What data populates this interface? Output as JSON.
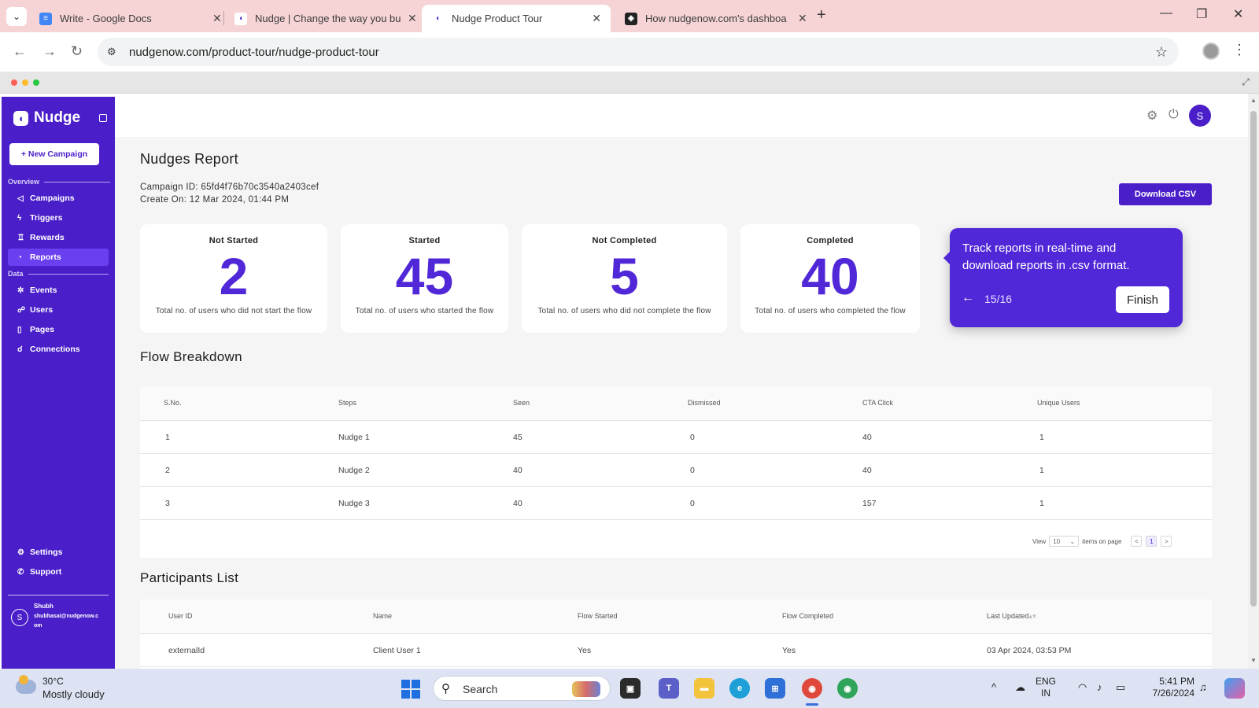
{
  "browser": {
    "tabs": [
      {
        "title": "Write - Google Docs",
        "favicon_color": "#4285f4",
        "active": false
      },
      {
        "title": "Nudge | Change the way you bu",
        "favicon_color": "#4a1fc9",
        "active": false
      },
      {
        "title": "Nudge Product Tour",
        "favicon_color": "#4a1fc9",
        "active": true
      },
      {
        "title": "How nudgenow.com's dashboa",
        "favicon_color": "#222222",
        "active": false
      }
    ],
    "url": "nudgenow.com/product-tour/nudge-product-tour"
  },
  "sidebar": {
    "brand": "Nudge",
    "new_campaign": "+ New Campaign",
    "section_overview": "Overview",
    "overview_items": [
      {
        "label": "Campaigns",
        "icon": "megaphone-icon",
        "active": false
      },
      {
        "label": "Triggers",
        "icon": "lightning-icon",
        "active": false
      },
      {
        "label": "Rewards",
        "icon": "trophy-icon",
        "active": false
      },
      {
        "label": "Reports",
        "icon": "pie-chart-icon",
        "active": true
      }
    ],
    "section_data": "Data",
    "data_items": [
      {
        "label": "Events",
        "icon": "sparkle-icon"
      },
      {
        "label": "Users",
        "icon": "users-icon"
      },
      {
        "label": "Pages",
        "icon": "page-icon"
      },
      {
        "label": "Connections",
        "icon": "connections-icon"
      }
    ],
    "bottom_items": [
      {
        "label": "Settings",
        "icon": "gear-icon"
      },
      {
        "label": "Support",
        "icon": "phone-icon"
      }
    ],
    "user": {
      "initial": "S",
      "name": "Shubh",
      "email": "shubhasai@nudgenow.com"
    }
  },
  "header": {
    "avatar_initial": "S"
  },
  "report": {
    "title": "Nudges Report",
    "campaign_id": "Campaign ID: 65fd4f76b70c3540a2403cef",
    "created_on": "Create On: 12 Mar 2024, 01:44 PM",
    "download_label": "Download CSV"
  },
  "stats": [
    {
      "label": "Not Started",
      "value": "2",
      "desc": "Total no. of users who did not start the flow"
    },
    {
      "label": "Started",
      "value": "45",
      "desc": "Total no. of users who started the flow"
    },
    {
      "label": "Not Completed",
      "value": "5",
      "desc": "Total no. of users who did not complete the flow"
    },
    {
      "label": "Completed",
      "value": "40",
      "desc": "Total no. of users who completed the flow"
    }
  ],
  "tooltip": {
    "text": "Track reports in real-time and download reports in .csv format.",
    "step": "15/16",
    "finish_label": "Finish"
  },
  "flow_breakdown": {
    "title": "Flow Breakdown",
    "columns": [
      "S.No.",
      "Steps",
      "Seen",
      "Dismissed",
      "CTA Click",
      "Unique Users"
    ],
    "rows": [
      [
        "1",
        "Nudge 1",
        "45",
        "0",
        "40",
        "1"
      ],
      [
        "2",
        "Nudge 2",
        "40",
        "0",
        "40",
        "1"
      ],
      [
        "3",
        "Nudge 3",
        "40",
        "0",
        "157",
        "1"
      ]
    ],
    "pager": {
      "view_label": "View",
      "per_page": "10",
      "items_label": "items on page",
      "prev": "<",
      "page": "1",
      "next": ">"
    }
  },
  "participants": {
    "title": "Participants List",
    "columns": [
      "User ID",
      "Name",
      "Flow Started",
      "Flow Completed",
      "Last Updated"
    ],
    "rows": [
      [
        "externalId",
        "Client User 1",
        "Yes",
        "Yes",
        "03 Apr 2024, 03:53 PM"
      ]
    ]
  },
  "taskbar": {
    "temperature": "30°C",
    "weather": "Mostly cloudy",
    "search_label": "Search",
    "lang_top": "ENG",
    "lang_bottom": "IN",
    "time": "5:41 PM",
    "date": "7/26/2024"
  }
}
